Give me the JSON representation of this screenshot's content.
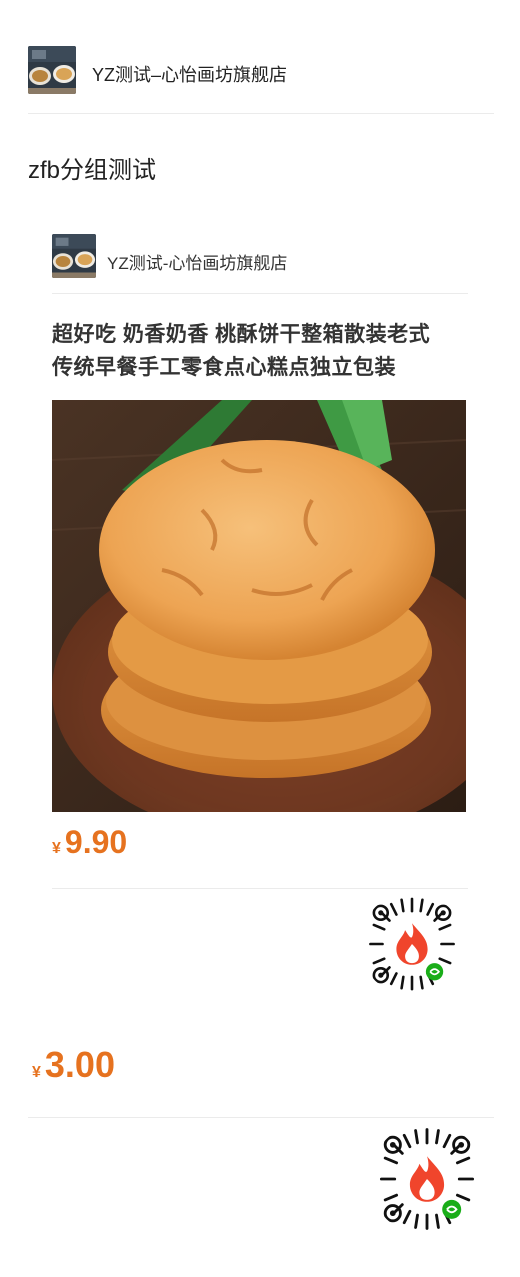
{
  "store": {
    "name": "YZ测试–心怡画坊旗舰店"
  },
  "group": {
    "title": "zfb分组测试"
  },
  "card": {
    "store_name": "YZ测试-心怡画坊旗舰店",
    "title_line1": "超好吃 奶香奶香 桃酥饼干整箱散装老式",
    "title_line2": "传统早餐手工零食点心糕点独立包装",
    "currency": "¥",
    "price": "9.90"
  },
  "second": {
    "currency": "¥",
    "price": "3.00"
  },
  "icons": {
    "store_avatar": "store-thumbnail-image",
    "product_image": "cookie-product-photo",
    "qr_code": "mini-program-qr-code-icon"
  },
  "colors": {
    "price": "#e6721f",
    "flame": "#f0452c",
    "mini_program_badge": "#1aad19"
  }
}
